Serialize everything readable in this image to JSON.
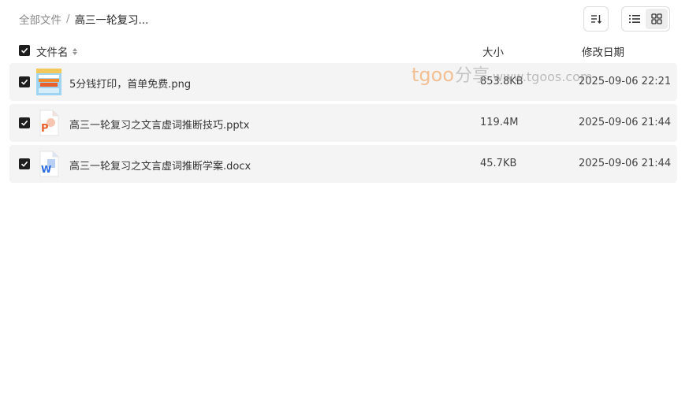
{
  "breadcrumb": {
    "root": "全部文件",
    "separator": "/",
    "current": "高三一轮复习..."
  },
  "toolbar": {
    "sort_icon": "sort-descending-icon",
    "list_view_icon": "list-view-icon",
    "grid_view_icon": "grid-view-icon",
    "active_view": "grid"
  },
  "table": {
    "columns": {
      "name": "文件名",
      "size": "大小",
      "date": "修改日期"
    },
    "rows": [
      {
        "icon": "image-thumbnail-icon",
        "name": "5分钱打印，首单免费.png",
        "size": "853.8KB",
        "date": "2025-09-06 22:21",
        "checked": true
      },
      {
        "icon": "ppt-file-icon",
        "name": "高三一轮复习之文言虚词推断技巧.pptx",
        "size": "119.4M",
        "date": "2025-09-06 21:44",
        "checked": true
      },
      {
        "icon": "word-file-icon",
        "name": "高三一轮复习之文言虚词推断学案.docx",
        "size": "45.7KB",
        "date": "2025-09-06 21:44",
        "checked": true
      }
    ]
  },
  "watermark": {
    "brand": "tgoo",
    "cn": "分享",
    "url": "www.tgoos.com"
  },
  "colors": {
    "row_bg": "#f4f4f4",
    "checkbox": "#1e1e1e",
    "ppt_orange": "#e8612c",
    "word_blue": "#2b6be0"
  }
}
